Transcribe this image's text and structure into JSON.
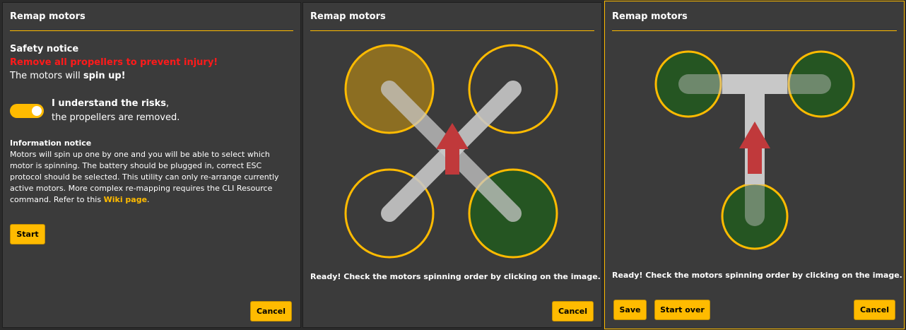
{
  "dialog_title": "Remap motors",
  "panel1": {
    "safety_title": "Safety notice",
    "safety_warning": "Remove all propellers to prevent injury!",
    "spin_prefix": "The motors will ",
    "spin_bold": "spin up!",
    "toggle_on": true,
    "understand_bold": "I understand the risks",
    "understand_comma": ",",
    "understand_rest": "the propellers are removed.",
    "info_title": "Information notice",
    "info_text": "Motors will spin up one by one and you will be able to select which motor is spinning. The battery should be plugged in, correct ESC protocol should be selected. This utility can only re-arrange currently active motors. More complex re-mapping requires the CLI Resource command. Refer to this ",
    "wiki_link": "Wiki page",
    "info_end": ".",
    "start_button": "Start",
    "cancel_button": "Cancel"
  },
  "panel2": {
    "status_text": "Ready! Check the motors spinning order by clicking on the image.",
    "cancel_button": "Cancel",
    "motors": [
      {
        "name": "front-left",
        "state": "spinning"
      },
      {
        "name": "front-right",
        "state": "idle"
      },
      {
        "name": "rear-left",
        "state": "idle"
      },
      {
        "name": "rear-right",
        "state": "selected"
      }
    ]
  },
  "panel3": {
    "status_text": "Ready! Check the motors spinning order by clicking on the image.",
    "save_button": "Save",
    "start_over_button": "Start over",
    "cancel_button": "Cancel",
    "motors": [
      {
        "name": "left",
        "state": "selected"
      },
      {
        "name": "right",
        "state": "selected"
      },
      {
        "name": "rear",
        "state": "selected"
      }
    ]
  },
  "colors": {
    "accent": "#ffbb00",
    "warning": "#ff1a1a",
    "panel_bg": "#3b3b3b",
    "motor_selected": "#255522",
    "motor_spinning": "#8c6e22",
    "frame": "#c8c8c8",
    "arrow": "#c0393b"
  }
}
